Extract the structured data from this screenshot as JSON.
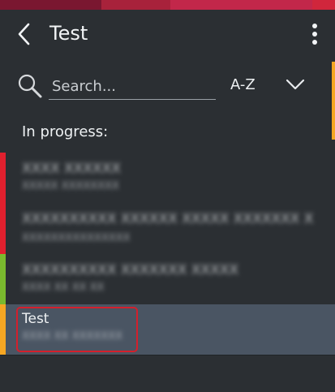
{
  "colors": {
    "background": "#2b2f33",
    "selected_bg": "#4a5563",
    "selection_outline": "#d41f2c",
    "accent_orange": "#f6a723"
  },
  "top_strip": [
    "#7a1730",
    "#a8223b",
    "#c2274a",
    "#d0263c",
    "#5a2a86"
  ],
  "header": {
    "title": "Test",
    "back_icon": "chevron-left-icon",
    "menu_icon": "kebab-menu-icon"
  },
  "search": {
    "placeholder": "Search...",
    "value": "",
    "icon": "search-icon"
  },
  "sort": {
    "label": "A-Z",
    "icon": "chevron-down-icon"
  },
  "section": {
    "title": "In progress:"
  },
  "items": [
    {
      "primary": "XXXX XXXXXX",
      "secondary": "XXXXX XXXXXXXX",
      "status_color": "#e0202e",
      "blurred": true
    },
    {
      "primary": "XXXXXXXXXX XXXXXX XXXXX XXXXXXX X",
      "secondary": "XXXXXXXXXXXXXXX",
      "status_color": "#e0202e",
      "blurred": true
    },
    {
      "primary": "XXXXXXXXXX XXXXXXX XXXXX",
      "secondary": "XXXX XX XX XX",
      "status_color": "#7ab92e",
      "blurred": true
    },
    {
      "primary": "Test",
      "secondary": "XXXX XX XXXXXXX",
      "status_color": "#f6a723",
      "blurred": false,
      "selected": true
    }
  ]
}
